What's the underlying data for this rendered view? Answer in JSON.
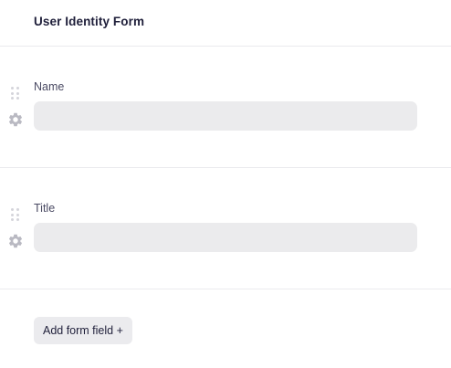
{
  "form": {
    "title": "User Identity Form",
    "fields": [
      {
        "label": "Name",
        "value": "",
        "placeholder": ""
      },
      {
        "label": "Title",
        "value": "",
        "placeholder": ""
      }
    ],
    "add_field_label": "Add form field +"
  },
  "icons": {
    "drag": "drag-handle-icon",
    "settings": "gear-icon"
  },
  "colors": {
    "input_bg": "#ebebed",
    "title_text": "#1f1f3a",
    "label_text": "#4a4a63",
    "icon_gray": "#b9b9c2",
    "divider": "#ebebee"
  }
}
